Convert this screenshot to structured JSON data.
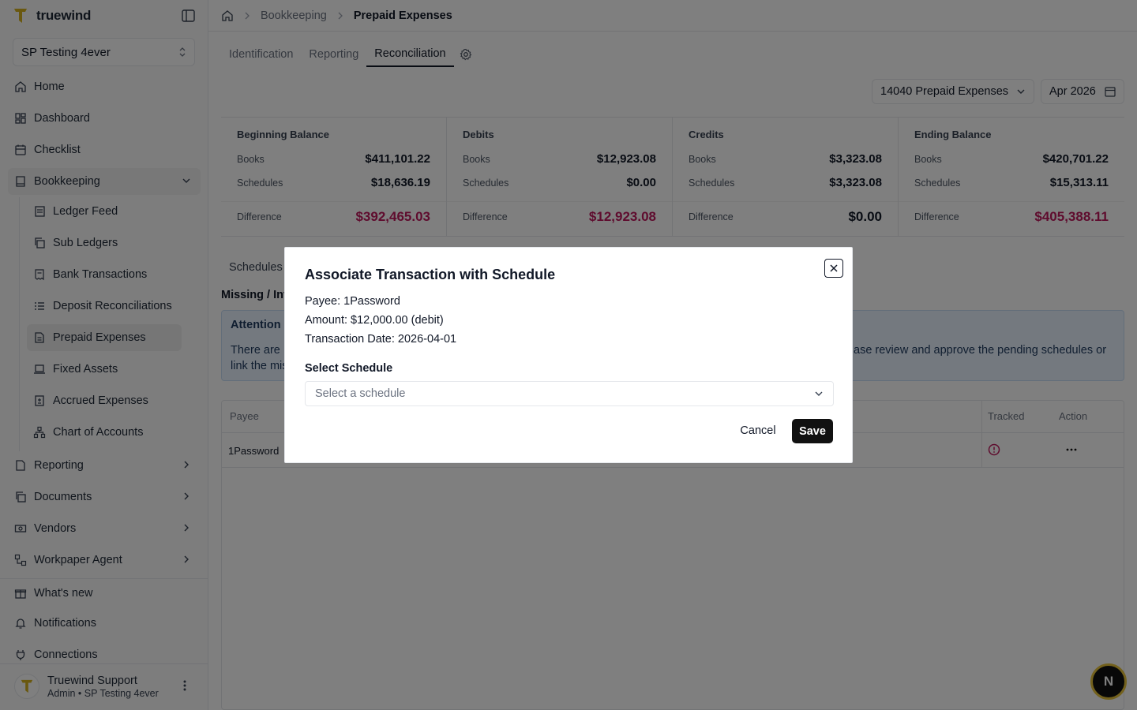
{
  "sidebar": {
    "brand": "truewind",
    "org": "SP Testing 4ever",
    "items": [
      {
        "label": "Home"
      },
      {
        "label": "Dashboard"
      },
      {
        "label": "Checklist"
      },
      {
        "label": "Bookkeeping"
      },
      {
        "label": "Reporting"
      },
      {
        "label": "Documents"
      },
      {
        "label": "Vendors"
      },
      {
        "label": "Workpaper Agent"
      }
    ],
    "subitems": [
      {
        "label": "Ledger Feed"
      },
      {
        "label": "Sub Ledgers"
      },
      {
        "label": "Bank Transactions"
      },
      {
        "label": "Deposit Reconciliations"
      },
      {
        "label": "Prepaid Expenses"
      },
      {
        "label": "Fixed Assets"
      },
      {
        "label": "Accrued Expenses"
      },
      {
        "label": "Chart of Accounts"
      }
    ],
    "bottom": [
      {
        "label": "What's new"
      },
      {
        "label": "Notifications"
      },
      {
        "label": "Connections"
      }
    ],
    "user": {
      "name": "Truewind Support",
      "role": "Admin • SP Testing 4ever"
    }
  },
  "breadcrumb": {
    "parent": "Bookkeeping",
    "current": "Prepaid Expenses"
  },
  "tabs": [
    {
      "label": "Identification"
    },
    {
      "label": "Reporting"
    },
    {
      "label": "Reconciliation"
    }
  ],
  "filters": {
    "account": "14040 Prepaid Expenses",
    "period": "Apr 2026"
  },
  "summary": {
    "books_label": "Books",
    "schedules_label": "Schedules",
    "difference_label": "Difference",
    "cards": [
      {
        "title": "Beginning Balance",
        "books": "$411,101.22",
        "schedules": "$18,636.19",
        "difference": "$392,465.03"
      },
      {
        "title": "Debits",
        "books": "$12,923.08",
        "schedules": "$0.00",
        "difference": "$12,923.08"
      },
      {
        "title": "Credits",
        "books": "$3,323.08",
        "schedules": "$3,323.08",
        "difference": "$0.00"
      },
      {
        "title": "Ending Balance",
        "books": "$420,701.22",
        "schedules": "$15,313.11",
        "difference": "$405,388.11"
      }
    ]
  },
  "section": {
    "tab": "Schedules",
    "subtitle": "Missing / Inv"
  },
  "alert": {
    "title": "Attention R",
    "line1": "There are",
    "line2": "link the mis",
    "line1_right": "ase review and approve the pending schedules or"
  },
  "table": {
    "headers": {
      "payee": "Payee",
      "tracked": "Tracked",
      "action": "Action"
    },
    "row": {
      "payee": "1Password"
    }
  },
  "modal": {
    "title": "Associate Transaction with Schedule",
    "payee": "Payee: 1Password",
    "amount": "Amount: $12,000.00 (debit)",
    "date": "Transaction Date: 2026-04-01",
    "select_label": "Select Schedule",
    "select_placeholder": "Select a schedule",
    "cancel": "Cancel",
    "save": "Save"
  },
  "badge": "N",
  "colors": {
    "accent_diff": "#be185d",
    "alert_bg": "#e8f2ff",
    "brand_yellow": "#e6c23a"
  }
}
